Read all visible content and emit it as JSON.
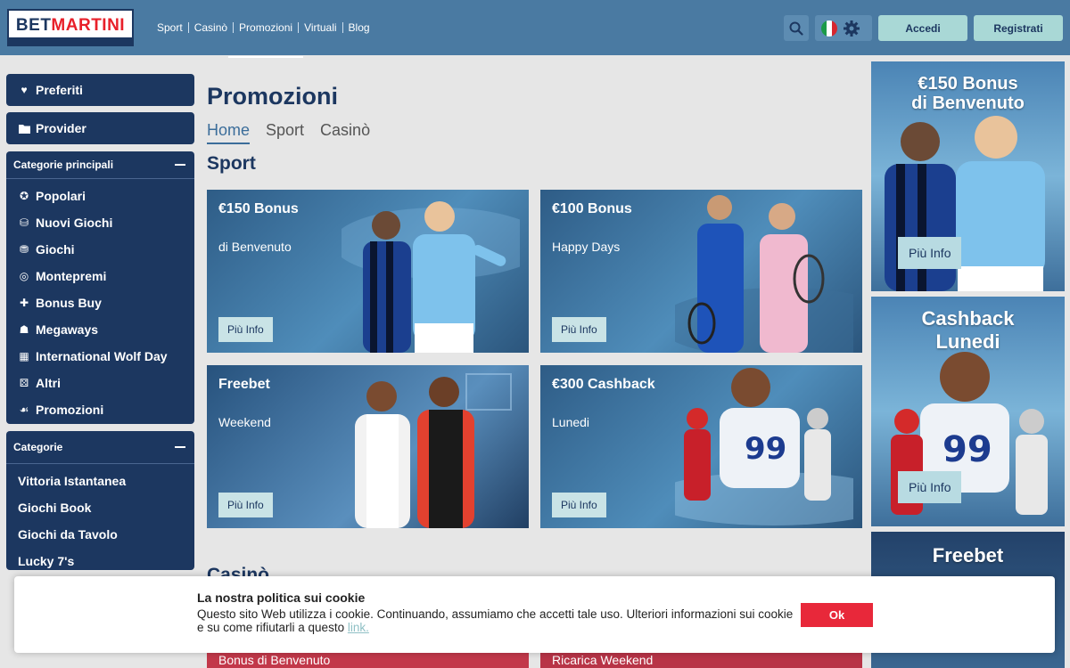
{
  "header": {
    "logo_bet": "BET",
    "logo_martini": "MARTINI",
    "nav": [
      "Sport",
      "Casinò",
      "Promozioni",
      "Virtuali",
      "Blog"
    ],
    "nav_active": "Promozioni",
    "login_label": "Accedi",
    "register_label": "Registrati",
    "language_flag": "flag-italy-icon"
  },
  "sidebar": {
    "favorites": "Preferiti",
    "provider": "Provider",
    "main_categories_title": "Categorie principali",
    "main_categories": [
      {
        "label": "Popolari",
        "icon": "popular-icon"
      },
      {
        "label": "Nuovi Giochi",
        "icon": "new-games-icon"
      },
      {
        "label": "Giochi",
        "icon": "games-icon"
      },
      {
        "label": "Montepremi",
        "icon": "jackpot-icon"
      },
      {
        "label": "Bonus Buy",
        "icon": "bonus-buy-icon"
      },
      {
        "label": "Megaways",
        "icon": "megaways-icon"
      },
      {
        "label": "International Wolf Day",
        "icon": "wolf-day-icon"
      },
      {
        "label": "Altri",
        "icon": "others-icon"
      },
      {
        "label": "Promozioni",
        "icon": "promotions-icon"
      }
    ],
    "categories_title": "Categorie",
    "categories": [
      "Vittoria Istantanea",
      "Giochi Book",
      "Giochi da Tavolo",
      "Lucky 7's"
    ]
  },
  "main": {
    "title": "Promozioni",
    "tabs": [
      "Home",
      "Sport",
      "Casinò"
    ],
    "active_tab": "Home",
    "sport_title": "Sport",
    "casino_title": "Casinò",
    "more_info": "Più Info",
    "promos": [
      {
        "title": "€150 Bonus",
        "subtitle": "di Benvenuto"
      },
      {
        "title": "€100 Bonus",
        "subtitle": "Happy Days"
      },
      {
        "title": "Freebet",
        "subtitle": "Weekend"
      },
      {
        "title": "€300 Cashback",
        "subtitle": "Lunedi"
      }
    ],
    "casino_peek": [
      "Bonus di Benvenuto",
      "Ricarica Weekend"
    ]
  },
  "right_banners": [
    {
      "title_line1": "€150 Bonus",
      "title_line2": "di Benvenuto",
      "button": "Più Info"
    },
    {
      "title_line1": "Cashback",
      "title_line2": "Lunedi",
      "button": "Più Info"
    },
    {
      "title_line1": "Freebet",
      "title_line2": ""
    }
  ],
  "cookie": {
    "title": "La nostra politica sui cookie",
    "text": "Questo sito Web utilizza i cookie. Continuando, assumiamo che accetti tale uso. Ulteriori informazioni sui cookie e su come rifiutarli a questo ",
    "link": "link.",
    "ok": "Ok"
  },
  "colors": {
    "header": "#4a7aa2",
    "sidebar": "#1c3760",
    "accent_button": "#a9d8d6",
    "cookie_ok": "#e8283a"
  }
}
